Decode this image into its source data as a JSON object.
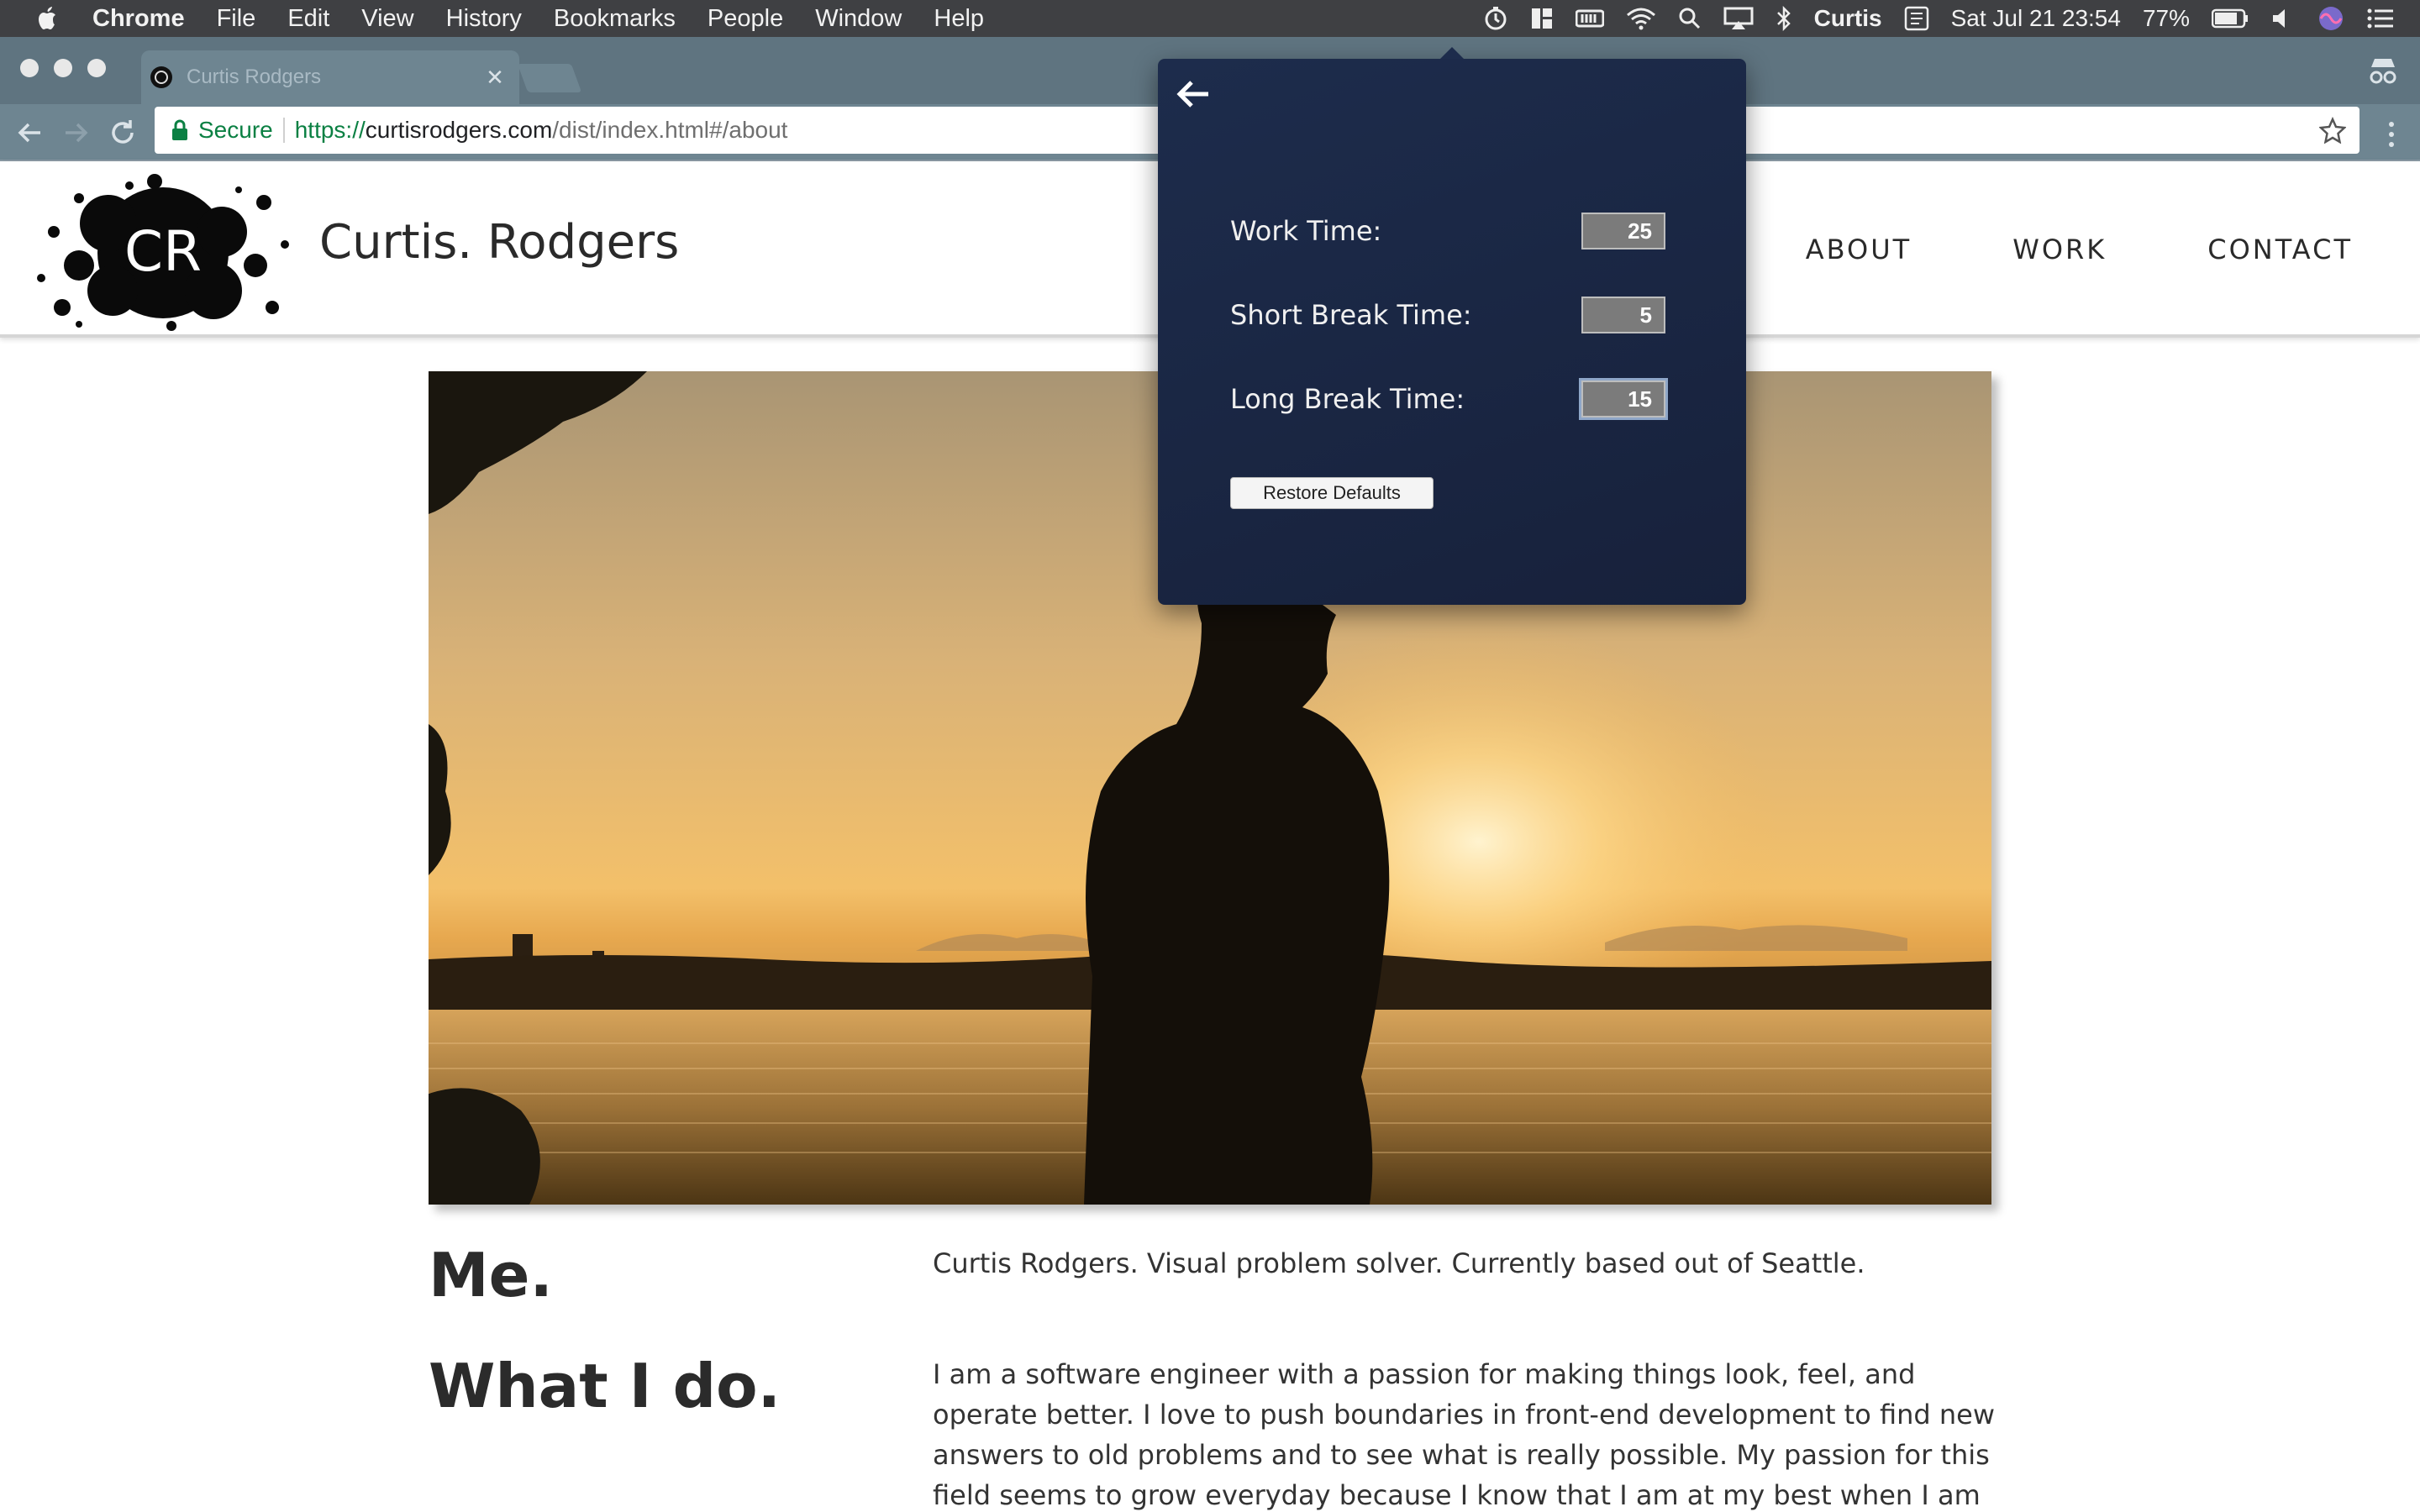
{
  "menubar": {
    "app_name": "Chrome",
    "items": [
      "File",
      "Edit",
      "View",
      "History",
      "Bookmarks",
      "People",
      "Window",
      "Help"
    ],
    "status": {
      "user": "Curtis",
      "datetime": "Sat Jul 21  23:54",
      "battery": "77%"
    }
  },
  "browser": {
    "tab_title": "Curtis Rodgers",
    "url": {
      "secure_label": "Secure",
      "scheme": "https://",
      "host": "curtisrodgers.com",
      "path": "/dist/index.html#/about"
    }
  },
  "site": {
    "name": "Curtis. Rodgers",
    "logo_text": "CR",
    "nav": [
      "ABOUT",
      "WORK",
      "CONTACT"
    ],
    "sections": [
      {
        "heading": "Me.",
        "text": "Curtis Rodgers. Visual problem solver. Currently based out of Seattle."
      },
      {
        "heading": "What I do.",
        "text": "I am a software engineer with a passion for making things look, feel, and operate better. I love to push boundaries in front-end development to find new answers to old problems and to see what is really possible. My passion for this field seems to grow everyday because I know that I am at my best when I am creating."
      }
    ]
  },
  "timer_settings": {
    "fields": [
      {
        "label": "Work Time:",
        "value": "25"
      },
      {
        "label": "Short Break Time:",
        "value": "5"
      },
      {
        "label": "Long Break Time:",
        "value": "15"
      }
    ],
    "restore_label": "Restore Defaults"
  },
  "colors": {
    "menubar": "#3f4043",
    "tabstrip": "#5f7480",
    "popover": "#1b2846",
    "secure_green": "#0b8043"
  }
}
